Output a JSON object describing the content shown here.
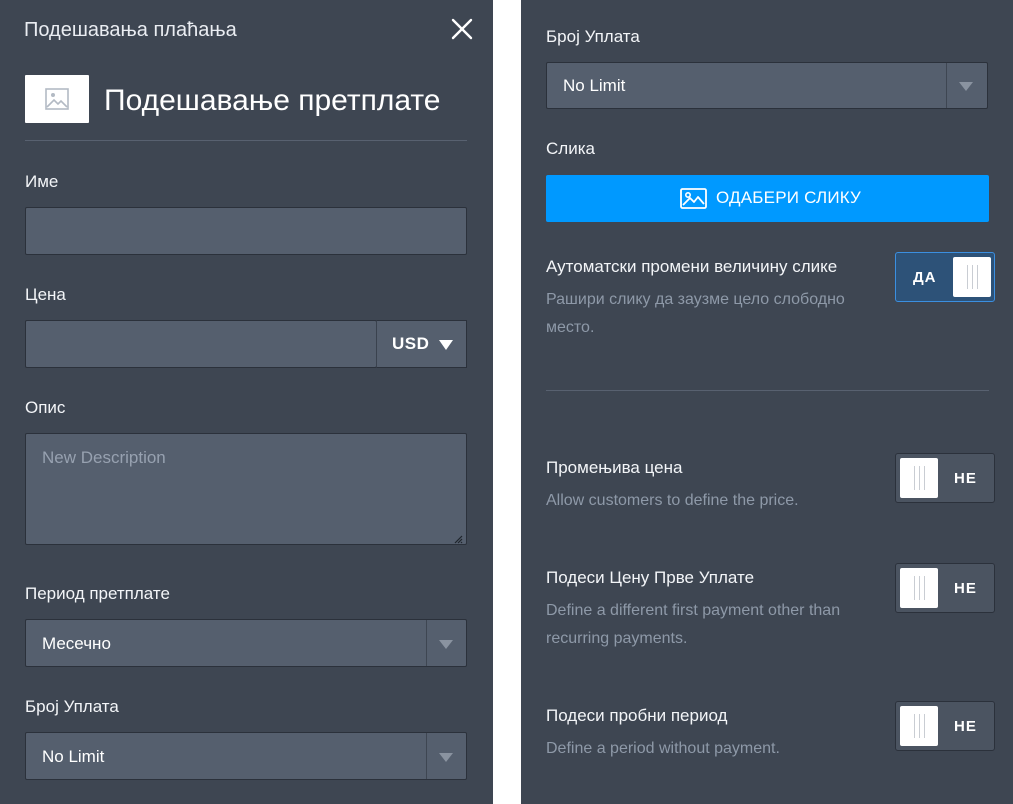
{
  "left": {
    "header_title": "Подешавања плаћања",
    "section_title": "Подешавање претплате",
    "name": {
      "label": "Име",
      "value": ""
    },
    "price": {
      "label": "Цена",
      "value": "",
      "currency": "USD"
    },
    "description": {
      "label": "Опис",
      "placeholder": "New Description"
    },
    "period": {
      "label": "Период претплате",
      "value": "Месечно"
    },
    "payments": {
      "label": "Број Уплата",
      "value": "No Limit"
    }
  },
  "right": {
    "payments": {
      "label": "Број Уплата",
      "value": "No Limit"
    },
    "image": {
      "label": "Слика",
      "button_label": "ОДАБЕРИ СЛИКУ"
    },
    "auto_resize": {
      "title": "Аутоматски промени величину слике",
      "desc_line1": "Рашири слику да заузме цело слободно",
      "desc_line2": "место.",
      "toggle_label": "ДА",
      "on": true
    },
    "variable_price": {
      "title": "Промењива цена",
      "desc": "Allow customers to define the price.",
      "toggle_label": "НЕ",
      "on": false
    },
    "first_payment": {
      "title": "Подеси Цену Прве Уплате",
      "desc_line1": "Define a different first payment other than",
      "desc_line2": "recurring payments.",
      "toggle_label": "НЕ",
      "on": false
    },
    "trial": {
      "title": "Подеси пробни период",
      "desc": "Define a period without payment.",
      "toggle_label": "НЕ",
      "on": false
    }
  },
  "colors": {
    "panel_bg": "#3e4652",
    "input_bg": "#555f6e",
    "accent_blue": "#0099ff",
    "toggle_on_border": "#3b8fe0"
  }
}
